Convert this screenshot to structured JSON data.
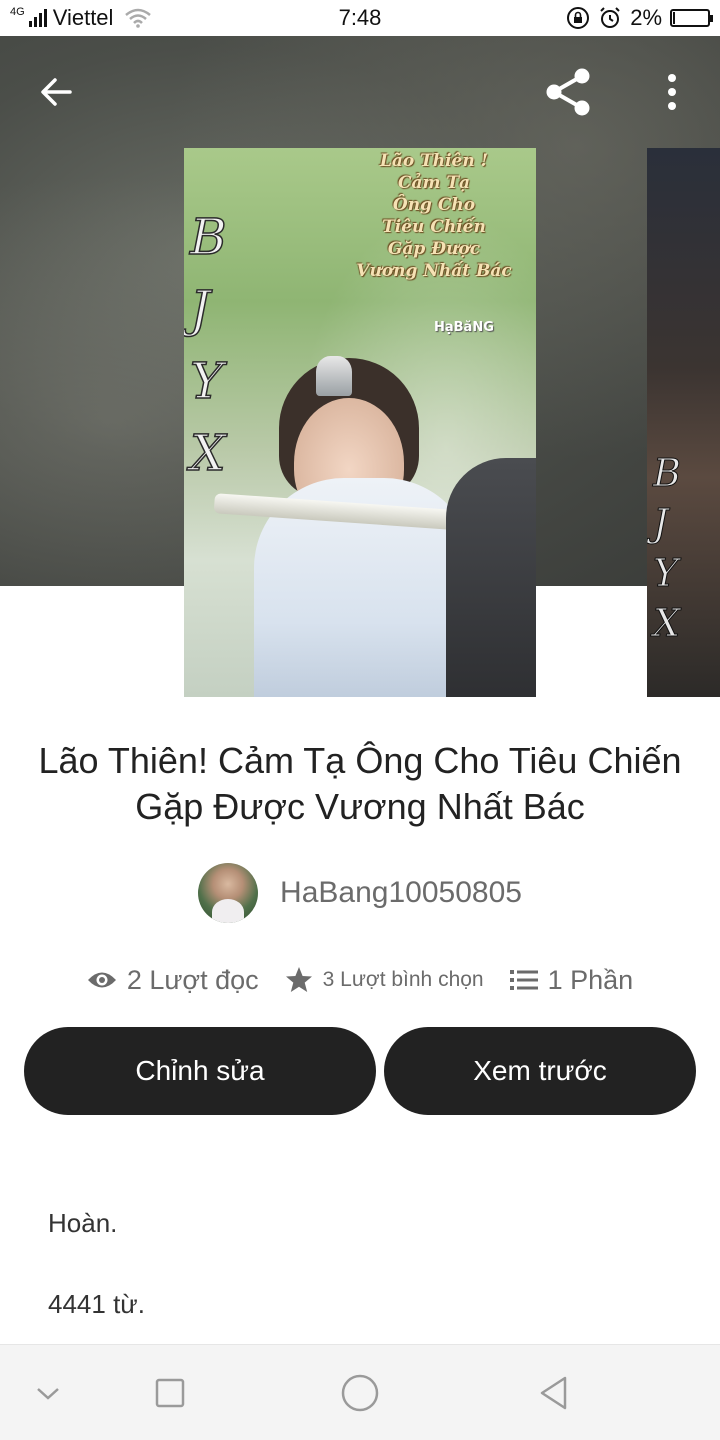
{
  "status_bar": {
    "network": "4G",
    "carrier": "Viettel",
    "time": "7:48",
    "battery_percent": "2%"
  },
  "header": {
    "back_icon": "arrow-left-icon",
    "share_icon": "share-icon",
    "more_icon": "more-vertical-icon"
  },
  "cover": {
    "letters": [
      "B",
      "J",
      "Y",
      "X"
    ],
    "title_lines": [
      "Lão Thiên !",
      "Cảm Tạ",
      "Ông Cho",
      "Tiêu Chiến",
      "Gặp Được",
      "Vương Nhất Bác"
    ],
    "credit": "HạBăNG"
  },
  "next_cover": {
    "letters": [
      "B",
      "J",
      "Y",
      "X"
    ]
  },
  "story": {
    "title": "Lão Thiên! Cảm Tạ Ông Cho Tiêu Chiến Gặp Được Vương Nhất Bác",
    "author": "HaBang10050805"
  },
  "stats": {
    "reads": "2 Lượt đọc",
    "votes": "3 Lượt bình chọn",
    "parts": "1 Phần"
  },
  "actions": {
    "edit_label": "Chỉnh sửa",
    "preview_label": "Xem trước"
  },
  "description": {
    "line1": "Hoàn.",
    "line2": "4441 từ."
  },
  "colors": {
    "button_bg": "#222222",
    "text_primary": "#222222",
    "text_secondary": "#6b6b6b"
  },
  "nav": {
    "icons": [
      "chevron-down-icon",
      "recent-apps-icon",
      "home-icon",
      "back-triangle-icon"
    ]
  }
}
